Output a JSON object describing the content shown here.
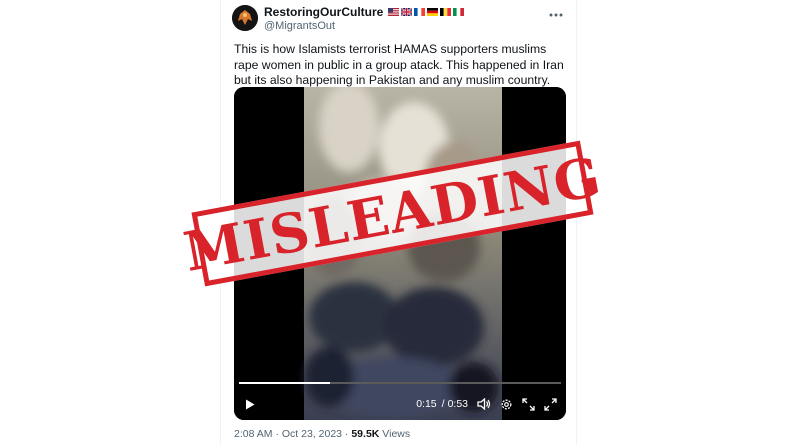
{
  "tweet": {
    "display_name": "RestoringOurCulture",
    "flags": [
      "us-flag",
      "uk-flag",
      "france-flag",
      "germany-flag",
      "belgium-flag",
      "italy-flag"
    ],
    "handle": "@MigrantsOut",
    "text": "This is how Islamists terrorist HAMAS supporters muslims rape women in public in a group atack. This happened in Iran but its also happening in Pakistan and any muslim country.",
    "more_icon": "more-icon"
  },
  "video": {
    "current_time": "0:15",
    "separator": "/",
    "duration": "0:53",
    "progress_fraction": 0.283,
    "icons": [
      "play-icon",
      "volume-icon",
      "settings-icon",
      "fullscreen-icon",
      "picture-in-picture-icon"
    ]
  },
  "stamp": {
    "text": "MISLEADING",
    "color": "#d8232a"
  },
  "meta": {
    "time": "2:08 AM",
    "dot": "·",
    "date": "Oct 23, 2023",
    "dot2": "·",
    "views_count": "59.5K",
    "views_label": "Views"
  }
}
